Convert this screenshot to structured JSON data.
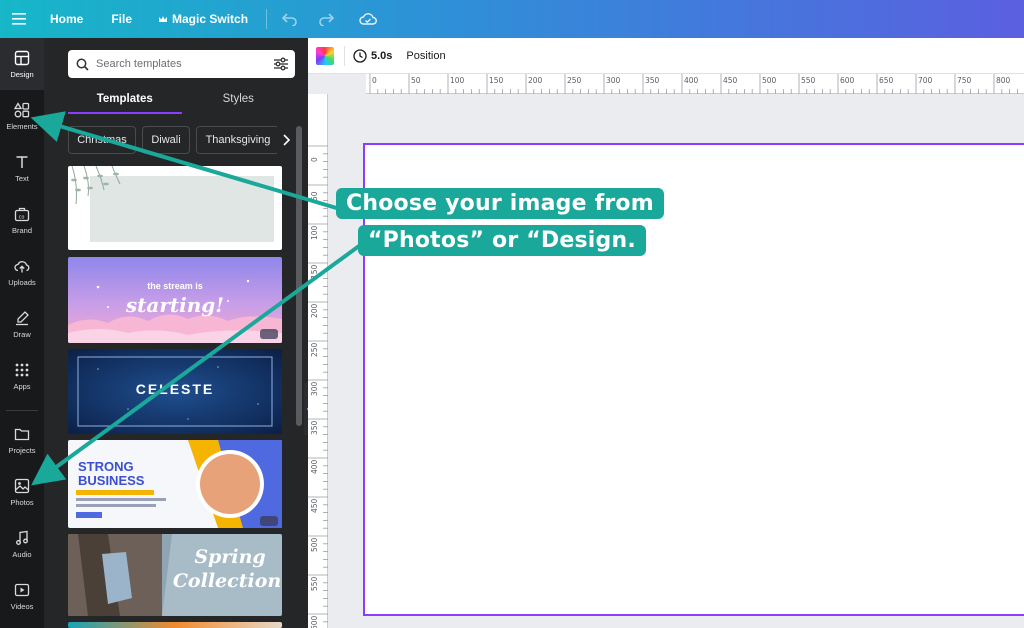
{
  "topbar": {
    "home": "Home",
    "file": "File",
    "magic_switch": "Magic Switch"
  },
  "rail": {
    "items": [
      {
        "label": "Design",
        "icon": "layout-icon"
      },
      {
        "label": "Elements",
        "icon": "shapes-icon"
      },
      {
        "label": "Text",
        "icon": "text-icon"
      },
      {
        "label": "Brand",
        "icon": "brand-icon"
      },
      {
        "label": "Uploads",
        "icon": "cloud-upload-icon"
      },
      {
        "label": "Draw",
        "icon": "pen-icon"
      },
      {
        "label": "Apps",
        "icon": "grid-icon"
      },
      {
        "label": "Projects",
        "icon": "folder-icon"
      },
      {
        "label": "Photos",
        "icon": "image-icon"
      },
      {
        "label": "Audio",
        "icon": "music-icon"
      },
      {
        "label": "Videos",
        "icon": "video-icon"
      }
    ]
  },
  "panel": {
    "search_placeholder": "Search templates",
    "tabs": [
      "Templates",
      "Styles"
    ],
    "chips": [
      "Christmas",
      "Diwali",
      "Thanksgiving"
    ]
  },
  "thumbnails": {
    "stream_line1": "the stream is",
    "stream_line2": "starting!",
    "celeste_title": "CELESTE",
    "business_line1": "STRONG",
    "business_line2": "BUSINESS",
    "spring_line1": "Spring",
    "spring_line2": "Collection"
  },
  "editor": {
    "duration": "5.0s",
    "position": "Position"
  },
  "ruler": {
    "top": [
      "0",
      "50",
      "100",
      "150",
      "200",
      "250",
      "300",
      "350",
      "400",
      "450",
      "500",
      "550",
      "600",
      "650",
      "700",
      "750",
      "800"
    ],
    "left": [
      "0",
      "50",
      "100",
      "150",
      "200",
      "250",
      "300",
      "350",
      "400",
      "450",
      "500",
      "550",
      "600"
    ]
  },
  "callout": {
    "line1": "Choose your image from",
    "line2": "“Photos” or “Design."
  },
  "colors": {
    "accent": "#8b3dff",
    "callout": "#1aa89a",
    "rail_bg": "#18191b",
    "panel_bg": "#252627"
  }
}
